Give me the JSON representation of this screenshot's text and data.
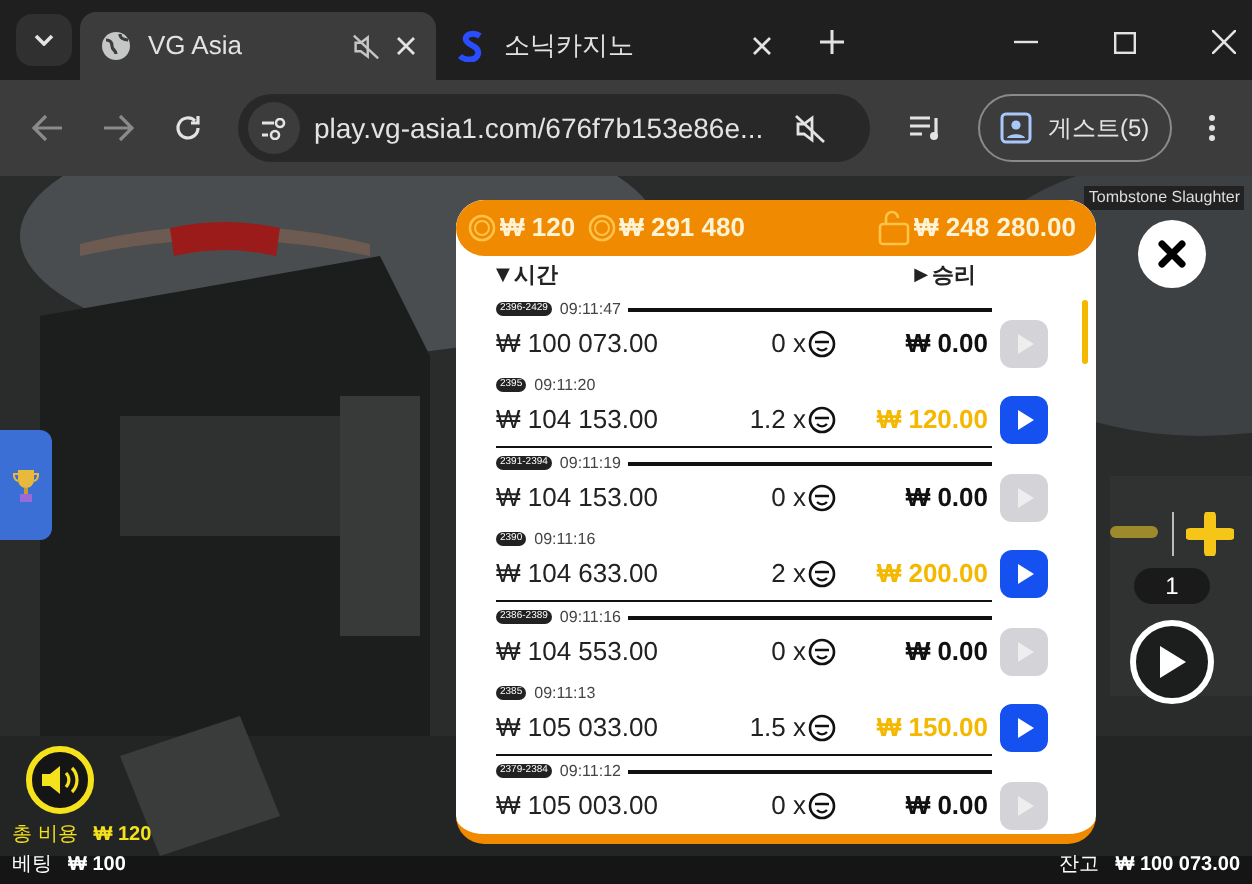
{
  "browser": {
    "tabs": [
      {
        "title": "VG Asia",
        "selected": true,
        "muted": true
      },
      {
        "title": "소닉카지노",
        "selected": false,
        "muted": false
      }
    ],
    "url": "play.vg-asia1.com/676f7b153e86e...",
    "profile": "게스트(5)"
  },
  "game": {
    "title_tag": "Tombstone Slaughter",
    "total_cost_label": "총 비용",
    "total_cost": "₩ 120",
    "bet_label": "베팅",
    "bet": "₩ 100",
    "balance_label": "잔고",
    "balance": "₩ 100 073.00",
    "counter": "1"
  },
  "history": {
    "header": {
      "bet": "₩ 120",
      "jackpot": "₩ 291 480",
      "wallet": "₩ 248 280.00"
    },
    "columns": [
      {
        "label": "시간",
        "caret": "▼"
      },
      {
        "label": "승리",
        "caret": "▶"
      }
    ],
    "rows": [
      {
        "kind": "lose",
        "badge": "2396-2429",
        "time": "09:11:47",
        "balance": "₩ 100 073.00",
        "multiplier": "0 x",
        "win": "₩ 0.00"
      },
      {
        "kind": "win",
        "badge": "2395",
        "time": "09:11:20",
        "balance": "₩ 104 153.00",
        "multiplier": "1.2 x",
        "win": "₩ 120.00"
      },
      {
        "kind": "lose",
        "badge": "2391-2394",
        "time": "09:11:19",
        "balance": "₩ 104 153.00",
        "multiplier": "0 x",
        "win": "₩ 0.00"
      },
      {
        "kind": "win",
        "badge": "2390",
        "time": "09:11:16",
        "balance": "₩ 104 633.00",
        "multiplier": "2 x",
        "win": "₩ 200.00"
      },
      {
        "kind": "lose",
        "badge": "2386-2389",
        "time": "09:11:16",
        "balance": "₩ 104 553.00",
        "multiplier": "0 x",
        "win": "₩ 0.00"
      },
      {
        "kind": "win",
        "badge": "2385",
        "time": "09:11:13",
        "balance": "₩ 105 033.00",
        "multiplier": "1.5 x",
        "win": "₩ 150.00"
      },
      {
        "kind": "lose",
        "badge": "2379-2384",
        "time": "09:11:12",
        "balance": "₩ 105 003.00",
        "multiplier": "0 x",
        "win": "₩ 0.00"
      }
    ]
  }
}
